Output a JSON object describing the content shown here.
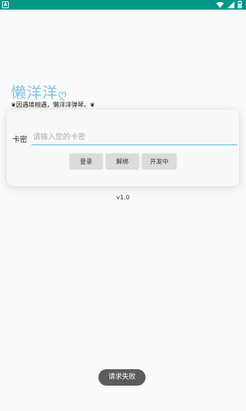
{
  "status_bar": {
    "left_badge": "A",
    "accent_color": "#009688",
    "icons": [
      "notification-a-icon",
      "wifi-icon",
      "signal-icon",
      "battery-icon"
    ]
  },
  "app": {
    "title": "懒洋洋",
    "title_deco": "ღ",
    "subtitle": "❦因遇境相遇，懒洋洋弹琴。❦"
  },
  "login_card": {
    "key_label": "卡密",
    "key_input_value": "",
    "key_input_placeholder": "请输入您的卡密",
    "buttons": {
      "login": "登录",
      "unbind": "解绑",
      "developing": "开发中"
    }
  },
  "version": "v1.0",
  "toast": "请求失败",
  "colors": {
    "title": "#7ec4e6",
    "input_underline": "#4fb3dd",
    "button_bg": "#dcdcdc",
    "toast_bg": "#5c5c5c"
  }
}
